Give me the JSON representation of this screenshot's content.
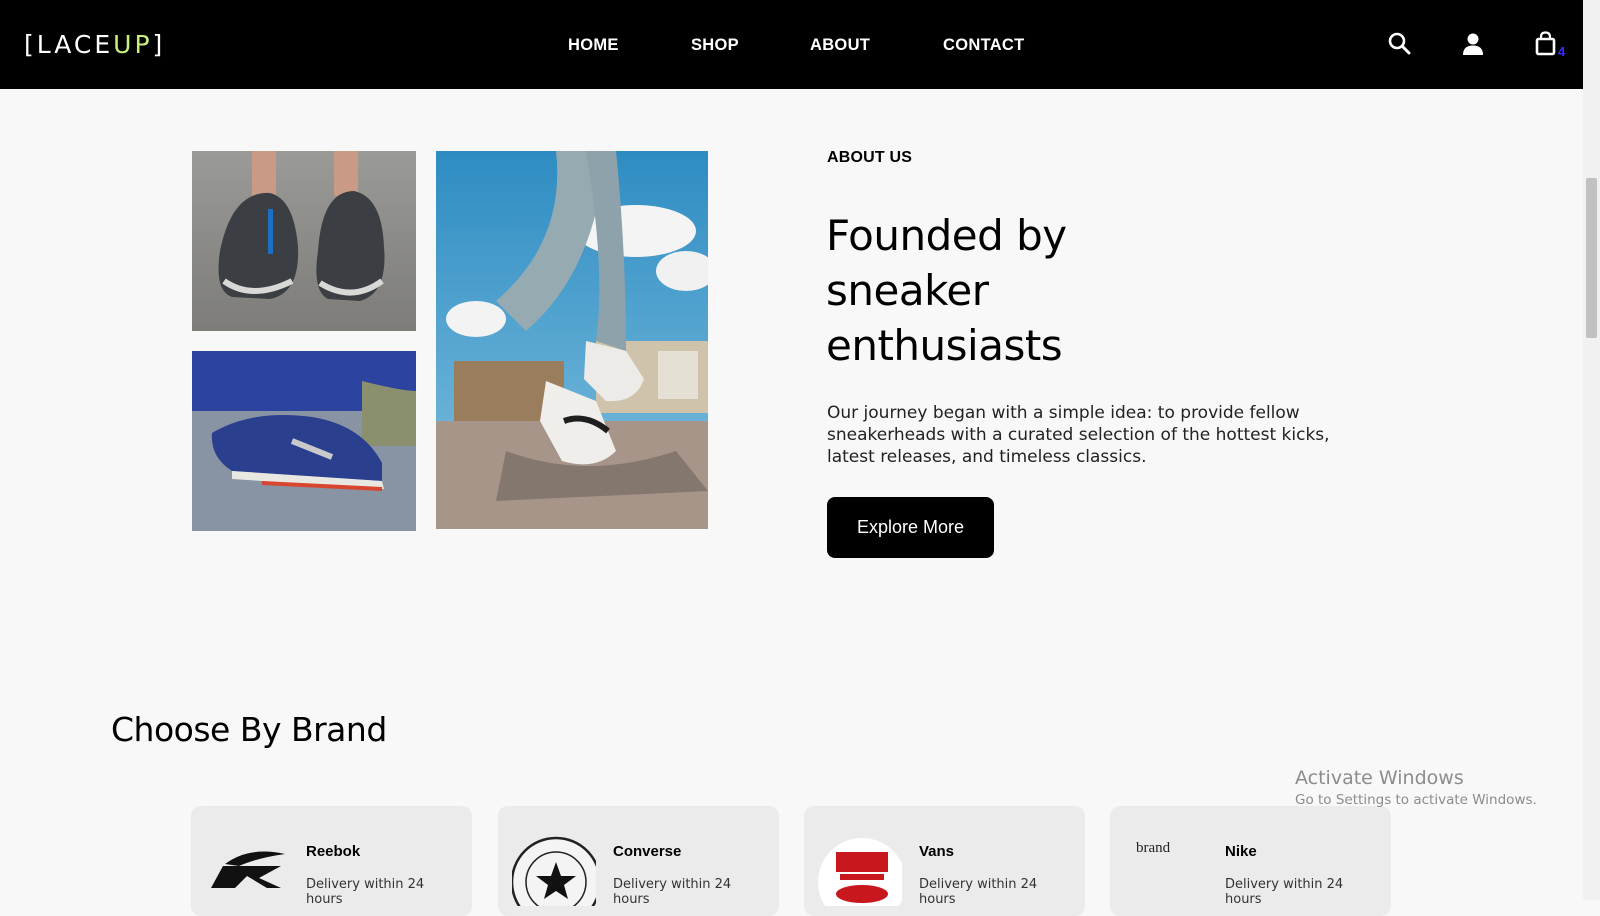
{
  "navbar": {
    "logo_left": "[LACE",
    "logo_accent": "UP",
    "logo_right": "]",
    "links": [
      "HOME",
      "SHOP",
      "ABOUT",
      "CONTACT"
    ],
    "icons": [
      "search-icon",
      "user-icon",
      "shopping-bag-icon"
    ],
    "cart_count": "4"
  },
  "about": {
    "eyebrow": "ABOUT US",
    "heading": "Founded by sneaker enthusiasts",
    "description": "Our journey began with a simple idea: to provide fellow sneakerheads with a curated selection of the hottest kicks, latest releases, and timeless classics.",
    "button_label": "Explore More"
  },
  "brands": {
    "title": "Choose By Brand",
    "items": [
      {
        "name": "Reebok",
        "delivery": "Delivery within 24 hours",
        "logo": "reebok-logo"
      },
      {
        "name": "Converse",
        "delivery": "Delivery within 24 hours",
        "logo": "converse-logo"
      },
      {
        "name": "Vans",
        "delivery": "Delivery within 24 hours",
        "logo": "vans-logo"
      },
      {
        "name": "Nike",
        "delivery": "Delivery within 24 hours",
        "logo": "broken-image",
        "alt": "brand"
      }
    ]
  },
  "watermark": {
    "title": "Activate Windows",
    "subtitle": "Go to Settings to activate Windows."
  },
  "colors": {
    "navbar_bg": "#000000",
    "logo_accent": "#c9f07a",
    "cart_count": "#3a2bff",
    "page_bg": "#f8f8f8",
    "card_bg": "#ebebeb"
  }
}
